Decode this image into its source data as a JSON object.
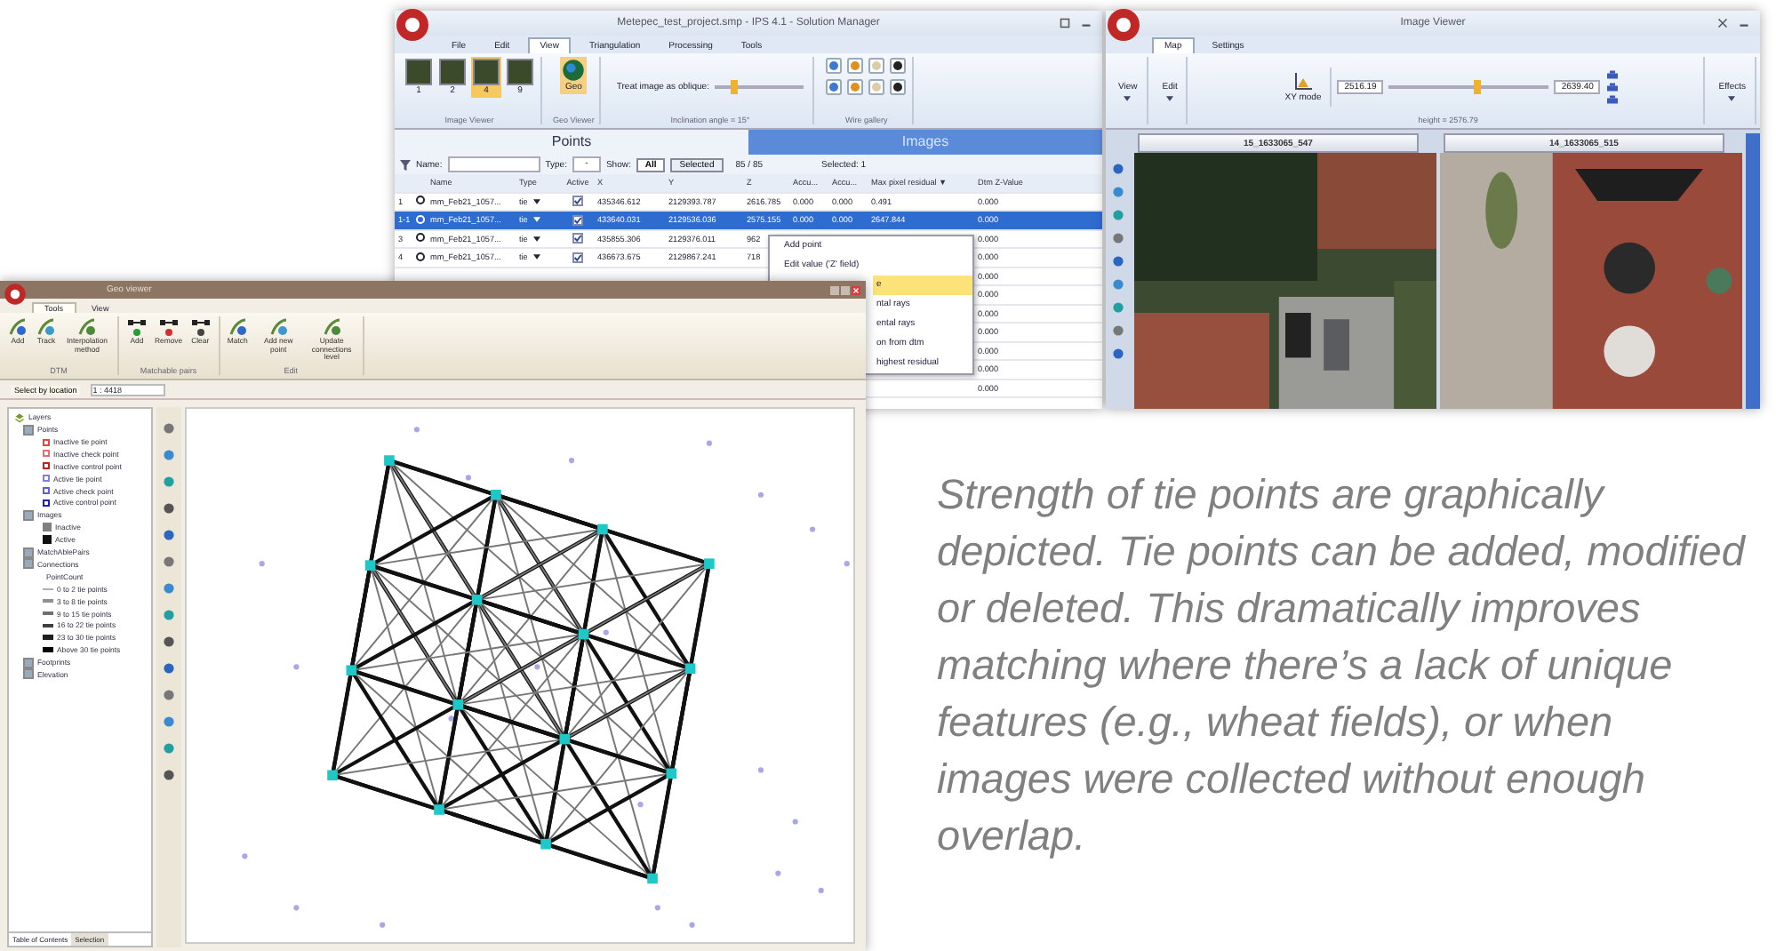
{
  "solution_manager": {
    "title": "Metepec_test_project.smp - IPS 4.1 - Solution Manager",
    "menu": [
      {
        "label": "File",
        "selected": false
      },
      {
        "label": "Edit",
        "selected": false
      },
      {
        "label": "View",
        "selected": true
      },
      {
        "label": "Triangulation",
        "selected": false
      },
      {
        "label": "Processing",
        "selected": false
      },
      {
        "label": "Tools",
        "selected": false
      }
    ],
    "layouts": [
      {
        "label": "1",
        "selected": false
      },
      {
        "label": "2",
        "selected": false
      },
      {
        "label": "4",
        "selected": true
      },
      {
        "label": "9",
        "selected": false
      }
    ],
    "image_viewer_group": "Image Viewer",
    "geo_button": "Geo",
    "geo_group": "Geo Viewer",
    "oblique_label": "Treat image as oblique:",
    "oblique_slider": {
      "level": 0.22
    },
    "inclination": "Inclination angle = 15°",
    "wire_gallery": "Wire gallery",
    "panels": [
      {
        "label": "Points",
        "selected": true
      },
      {
        "label": "Images",
        "selected": false
      }
    ],
    "filter": {
      "name_label": "Name:",
      "type_label": "Type:",
      "type_value": "-",
      "show_label": "Show:",
      "show": [
        {
          "label": "All",
          "selected": true
        },
        {
          "label": "Selected",
          "selected": false
        }
      ],
      "count": "85 / 85",
      "selected_count": "Selected: 1"
    },
    "columns": [
      "Name",
      "Type",
      "Active",
      "X",
      "Y",
      "Z",
      "Accu...",
      "Accu...",
      "Max pixel residual ▼",
      "Dtm Z-Value"
    ],
    "rows": [
      {
        "kind": "full",
        "index": "1",
        "name": "mm_Feb21_1057...",
        "type": "tie",
        "active": true,
        "selected": false,
        "cells": [
          "435346.612",
          "2129393.787",
          "2616.785",
          "0.000",
          "0.000",
          "0.491"
        ],
        "dtm": "0.000"
      },
      {
        "kind": "full",
        "index": "1-1",
        "name": "mm_Feb21_1057...",
        "type": "tie",
        "active": true,
        "selected": true,
        "cells": [
          "433640.031",
          "2129536.036",
          "2575.155",
          "0.000",
          "0.000",
          "2647.844"
        ],
        "dtm": "0.000"
      },
      {
        "kind": "full",
        "index": "3",
        "name": "mm_Feb21_1057...",
        "type": "tie",
        "active": true,
        "selected": false,
        "cells": [
          "435855.306",
          "2129376.011",
          "962"
        ],
        "dtm": "0.000"
      },
      {
        "kind": "full",
        "index": "4",
        "name": "mm_Feb21_1057...",
        "type": "tie",
        "active": true,
        "selected": false,
        "cells": [
          "436673.675",
          "2129867.241",
          "718"
        ],
        "dtm": "0.000"
      },
      {
        "kind": "tail",
        "dtm": "0.000"
      },
      {
        "kind": "tail",
        "dtm": "0.000"
      },
      {
        "kind": "tail",
        "dtm": "0.000"
      },
      {
        "kind": "tail",
        "dtm": "0.000"
      },
      {
        "kind": "tail",
        "dtm": "0.000"
      },
      {
        "kind": "tail",
        "dtm": "0.000"
      },
      {
        "kind": "tail",
        "dtm": "0.000"
      }
    ],
    "context_menu": [
      {
        "label": "Add point",
        "kind": "full",
        "selected": false
      },
      {
        "label": "Edit value ('Z' field)",
        "kind": "full",
        "selected": false
      },
      {
        "label": "e",
        "kind": "cut",
        "selected": true
      },
      {
        "label": "ntal rays",
        "kind": "cut",
        "selected": false
      },
      {
        "label": "ental rays",
        "kind": "cut",
        "selected": false
      },
      {
        "label": "on from dtm",
        "kind": "cut",
        "selected": false
      },
      {
        "label": "highest residual",
        "kind": "cut",
        "selected": false
      }
    ]
  },
  "image_viewer": {
    "title": "Image Viewer",
    "tabs": [
      {
        "label": "Map",
        "selected": true
      },
      {
        "label": "Settings",
        "selected": false
      }
    ],
    "view": "View",
    "edit": "Edit",
    "xy_mode": "XY mode",
    "low": "2516.19",
    "high": "2639.40",
    "height_slider": {
      "level": 0.55
    },
    "height": "height = 2576.79",
    "effects": "Effects",
    "images": [
      {
        "title": "15_1633065_547",
        "kind": "picture"
      },
      {
        "title": "14_1633065_515",
        "kind": "picture"
      }
    ]
  },
  "geo_viewer": {
    "title": "Geo viewer",
    "tabs": [
      {
        "label": "Tools",
        "selected": true
      },
      {
        "label": "View",
        "selected": false
      }
    ],
    "ribbon_groups": [
      {
        "label": "DTM",
        "buttons": [
          "Add",
          "Track",
          "Interpolation method"
        ]
      },
      {
        "label": "Matchable pairs",
        "buttons": [
          "Add",
          "Remove",
          "Clear"
        ]
      },
      {
        "label": "Edit",
        "buttons": [
          "Match",
          "Add new point",
          "Update connections level"
        ]
      }
    ],
    "select_by": "Select by location",
    "scale": "1 : 4418",
    "layers": [
      {
        "label": "Layers",
        "children": [
          {
            "label": "Points",
            "checked": true,
            "children": [
              {
                "label": "Inactive tie point",
                "kind": "legend",
                "color": "#e04848"
              },
              {
                "label": "Inactive check point",
                "kind": "legend",
                "color": "#e07070"
              },
              {
                "label": "Inactive control point",
                "kind": "legend",
                "color": "#c02020"
              },
              {
                "label": "Active tie point",
                "kind": "legend",
                "color": "#8080e0"
              },
              {
                "label": "Active check point",
                "kind": "legend",
                "color": "#6060d0"
              },
              {
                "label": "Active control point",
                "kind": "legend",
                "color": "#2020b0"
              }
            ]
          },
          {
            "label": "Images",
            "checked": true,
            "children": [
              {
                "label": "Inactive",
                "kind": "swatch",
                "color": "#808080"
              },
              {
                "label": "Active",
                "kind": "swatch",
                "color": "#101010"
              }
            ]
          },
          {
            "label": "MatchAblePairs",
            "checked": true
          },
          {
            "label": "Connections",
            "checked": true,
            "children": [
              {
                "label": "PointCount",
                "kind": "text"
              },
              {
                "label": "0 to 2 tie points",
                "kind": "line",
                "color": "#b0b0b0"
              },
              {
                "label": "3 to 8 tie points",
                "kind": "line",
                "color": "#909090"
              },
              {
                "label": "9 to 15 tie points",
                "kind": "line",
                "color": "#707070"
              },
              {
                "label": "16 to 22 tie points",
                "kind": "line",
                "color": "#404040"
              },
              {
                "label": "23 to 30 tie points",
                "kind": "line",
                "color": "#202020"
              },
              {
                "label": "Above 30 tie points",
                "kind": "line",
                "color": "#000000"
              }
            ]
          },
          {
            "label": "Footprints",
            "checked": true
          },
          {
            "label": "Elevation",
            "checked": true
          }
        ]
      }
    ],
    "bottom_tabs": [
      {
        "label": "Table of Contents",
        "selected": true
      },
      {
        "label": "Selection",
        "selected": false
      }
    ]
  },
  "caption": "Strength of tie points are graphically depicted. Tie points can be added, modified or deleted. This dramatically improves matching where there’s a lack of unique features (e.g., wheat fields), or when images were collected without enough overlap."
}
